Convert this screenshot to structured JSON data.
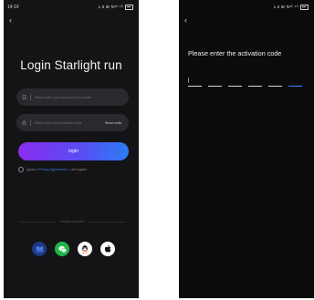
{
  "login_screen": {
    "status_time": "14:19",
    "status_icons": "1.8 ⊞ ⇅ᵃˡˡ ⁴ᴳ",
    "title": "Login Starlight run",
    "phone_placeholder": "Please enter your mobile phone number",
    "code_placeholder": "Please enter the verification code",
    "send_code_label": "Send code",
    "login_label": "login",
    "agree_prefix": "Agree ",
    "agreement_link": "<<Privacy Agreement>>",
    "agree_suffix": " , will register",
    "another_account_label": "another account",
    "socials": [
      {
        "icon": "mail-icon"
      },
      {
        "icon": "wechat-icon"
      },
      {
        "icon": "qq-icon"
      },
      {
        "icon": "apple-icon"
      }
    ],
    "colors": {
      "background": "#141416",
      "field": "#2a2a2e",
      "gradient_start": "#8a2cf0",
      "gradient_end": "#2c7cf5",
      "link": "#3d7ff5",
      "wechat": "#1fb84a",
      "mail": "#1e3a86"
    }
  },
  "activation_screen": {
    "status_icons": "1.8 ⊞ ⇅ᵃˡˡ ⁴ᴳ",
    "prompt": "Please enter the activation code",
    "slot_count": 6,
    "active_slot_color": "#2f8bf6"
  }
}
